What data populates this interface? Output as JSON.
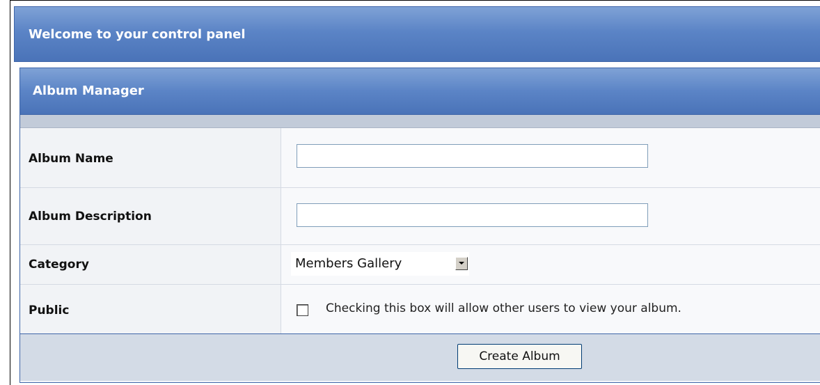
{
  "panel": {
    "title": "Welcome to your control panel"
  },
  "album_manager": {
    "title": "Album Manager",
    "fields": {
      "name_label": "Album Name",
      "name_value": "",
      "description_label": "Album Description",
      "description_value": "",
      "category_label": "Category",
      "category_selected": "Members Gallery",
      "public_label": "Public",
      "public_checked": false,
      "public_text": "Checking this box will allow other users to view your album."
    },
    "submit_label": "Create Album"
  },
  "colors": {
    "header_blue": "#5b84c6",
    "border_blue": "#3e65a8",
    "subbar_gray": "#c2cbd9",
    "footer_bg": "#d3dbe6"
  },
  "icons": {
    "select_arrow": "chevron-down-icon"
  }
}
